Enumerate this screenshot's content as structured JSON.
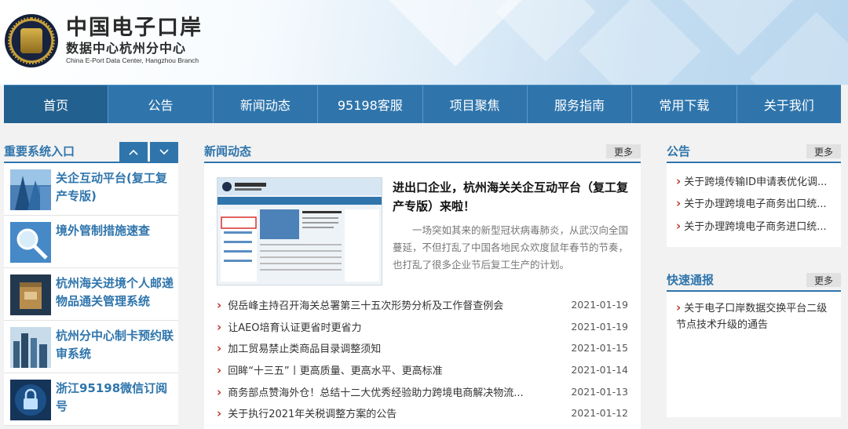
{
  "header": {
    "title_cn": "中国电子口岸",
    "subtitle_cn": "数据中心杭州分中心",
    "subtitle_en": "China E-Port Data Center, Hangzhou Branch"
  },
  "nav": [
    "首页",
    "公告",
    "新闻动态",
    "95198客服",
    "项目聚焦",
    "服务指南",
    "常用下载",
    "关于我们"
  ],
  "left": {
    "title": "重要系统入口",
    "up_icon": "chevron-up-icon",
    "down_icon": "chevron-down-icon",
    "items": [
      {
        "label": "关企互动平台(复工复产专版)",
        "icon": "building-photo"
      },
      {
        "label": "境外管制措施速查",
        "icon": "magnifier-photo"
      },
      {
        "label": "杭州海关进境个人邮递物品通关管理系统",
        "icon": "parcel-photo"
      },
      {
        "label": "杭州分中心制卡预约联审系统",
        "icon": "city-photo"
      },
      {
        "label": "浙江95198微信订阅号",
        "icon": "lock-photo"
      }
    ]
  },
  "news": {
    "title": "新闻动态",
    "more": "更多",
    "feature": {
      "title": "进出口企业，杭州海关关企互动平台（复工复产专版）来啦！",
      "summary": "一场突如其来的新型冠状病毒肺炎，从武汉向全国蔓延，不但打乱了中国各地民众欢度鼠年春节的节奏，也打乱了很多企业节后复工生产的计划。",
      "image": "website-screenshot"
    },
    "items": [
      {
        "title": "倪岳峰主持召开海关总署第三十五次形势分析及工作督查例会",
        "date": "2021-01-19"
      },
      {
        "title": "让AEO培育认证更省时更省力",
        "date": "2021-01-19"
      },
      {
        "title": "加工贸易禁止类商品目录调整须知",
        "date": "2021-01-15"
      },
      {
        "title": "回眸“十三五”丨更高质量、更高水平、更高标准",
        "date": "2021-01-14"
      },
      {
        "title": "商务部点赞海外仓！总结十二大优秀经验助力跨境电商解决物流...",
        "date": "2021-01-13"
      },
      {
        "title": "关于执行2021年关税调整方案的公告",
        "date": "2021-01-12"
      }
    ]
  },
  "notice": {
    "title": "公告",
    "more": "更多",
    "items": [
      "关于跨境传输ID申请表优化调...",
      "关于办理跨境电子商务出口统...",
      "关于办理跨境电子商务进口统..."
    ]
  },
  "quick": {
    "title": "快速通报",
    "more": "更多",
    "items": [
      "关于电子口岸数据交换平台二级节点技术升级的通告"
    ]
  },
  "colors": {
    "primary": "#2f75ac",
    "accent_red": "#c0392b"
  }
}
